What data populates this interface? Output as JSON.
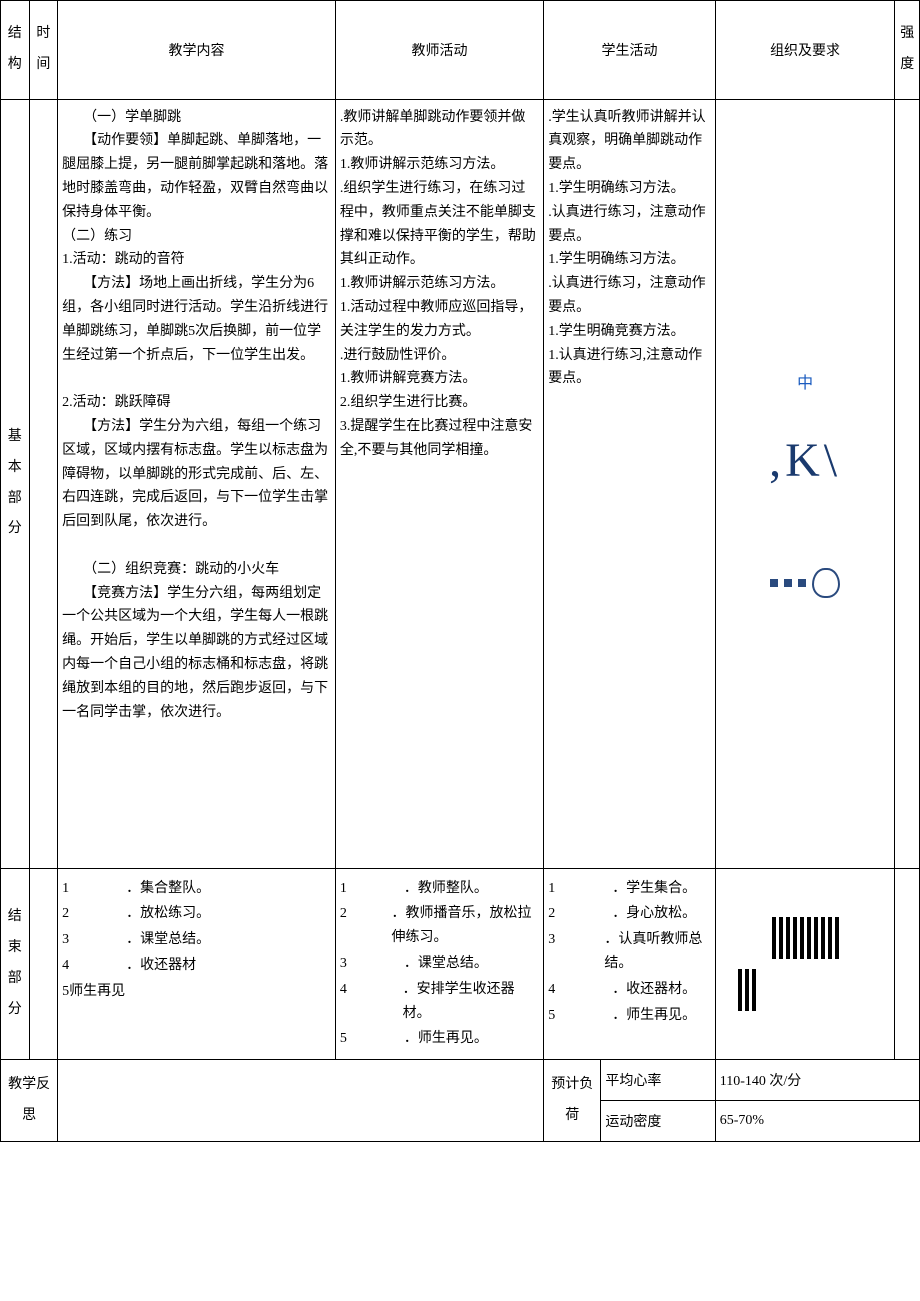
{
  "headers": {
    "structure": "结构",
    "time": "时间",
    "teaching_content": "教学内容",
    "teacher_activity": "教师活动",
    "student_activity": "学生活动",
    "organization": "组织及要求",
    "intensity": "强度"
  },
  "basic": {
    "label": "基本部分",
    "content": "　　（一）学单脚跳\n　　【动作要领】单脚起跳、单脚落地，一腿屈膝上提，另一腿前脚掌起跳和落地。落地时膝盖弯曲，动作轻盈，双臂自然弯曲以保持身体平衡。\n（二）练习\n1.活动：跳动的音符\n　　【方法】场地上画出折线，学生分为6组，各小组同时进行活动。学生沿折线进行单脚跳练习，单脚跳5次后换脚，前一位学生经过第一个折点后，下一位学生出发。\n\n2.活动：跳跃障碍\n　　【方法】学生分为六组，每组一个练习区域，区域内摆有标志盘。学生以标志盘为障碍物，以单脚跳的形式完成前、后、左、右四连跳，完成后返回，与下一位学生击掌后回到队尾，依次进行。\n\n　　（二）组织竞赛：跳动的小火车\n　　【竞赛方法】学生分六组，每两组划定一个公共区域为一个大组，学生每人一根跳绳。开始后，学生以单脚跳的方式经过区域内每一个自己小组的标志桶和标志盘，将跳绳放到本组的目的地，然后跑步返回，与下一名同学击掌，依次进行。",
    "teacher": ".教师讲解单脚跳动作要领并做示范。\n1.教师讲解示范练习方法。\n.组织学生进行练习，在练习过程中，教师重点关注不能单脚支撑和难以保持平衡的学生，帮助其纠正动作。\n1.教师讲解示范练习方法。\n1.活动过程中教师应巡回指导，关注学生的发力方式。\n.进行鼓励性评价。\n1.教师讲解竞赛方法。\n2.组织学生进行比赛。\n3.提醒学生在比赛过程中注意安全,不要与其他同学相撞。",
    "student": ".学生认真听教师讲解并认真观察，明确单脚跳动作要点。\n1.学生明确练习方法。\n.认真进行练习，注意动作要点。\n1.学生明确练习方法。\n.认真进行练习，注意动作要点。\n1.学生明确竞赛方法。\n1.认真进行练习,注意动作要点。",
    "intensity": "中"
  },
  "ending": {
    "label": "结束部分",
    "content_items": [
      {
        "n": "1",
        "t": "．集合整队。"
      },
      {
        "n": "2",
        "t": "．放松练习。"
      },
      {
        "n": "3",
        "t": "．课堂总结。"
      },
      {
        "n": "4",
        "t": "．收还器材"
      },
      {
        "n": "",
        "t": "5师生再见"
      }
    ],
    "teacher_items": [
      {
        "n": "1",
        "t": "．教师整队。"
      },
      {
        "n": "2",
        "t": "．教师播音乐，放松拉伸练习。"
      },
      {
        "n": "3",
        "t": "．课堂总结。"
      },
      {
        "n": "4",
        "t": "．安排学生收还器材。"
      },
      {
        "n": "5",
        "t": "．师生再见。"
      }
    ],
    "student_items": [
      {
        "n": "1",
        "t": "．学生集合。"
      },
      {
        "n": "2",
        "t": "．身心放松。"
      },
      {
        "n": "3",
        "t": "．认真听教师总结。"
      },
      {
        "n": "4",
        "t": "．收还器材。"
      },
      {
        "n": "5",
        "t": "．师生再见。"
      }
    ]
  },
  "reflection": {
    "label": "教学反思",
    "load_label": "预计负荷",
    "heart_rate_label": "平均心率",
    "heart_rate_value": "110-140 次/分",
    "density_label": "运动密度",
    "density_value": "65-70%"
  }
}
